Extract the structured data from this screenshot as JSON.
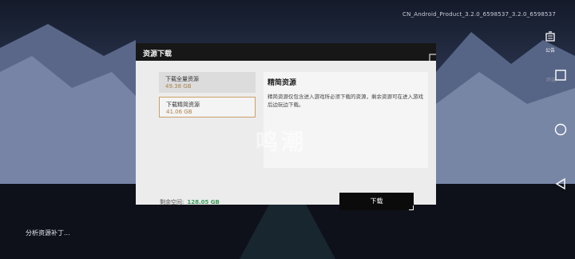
{
  "app": {
    "version": "CN_Android_Product_3.2.0_6598537_3.2.0_6598537",
    "status_text": "分析资源补丁...",
    "notice_label": "公告",
    "faint_label": "终端"
  },
  "dialog": {
    "title": "资源下载",
    "options": [
      {
        "label": "下载全量资源",
        "size": "49.38 GB",
        "selected": false
      },
      {
        "label": "下载精简资源",
        "size": "41.06 GB",
        "selected": true
      }
    ],
    "detail_title": "精简资源",
    "detail_desc": "精简资源仅包含进入游戏所必须下载的资源，剩余资源可在进入游戏后边玩边下载。",
    "watermark": "鸣潮",
    "free_space_label": "剩余空间:",
    "free_space_value": "128.05 GB",
    "download_label": "下载"
  },
  "colors": {
    "accent_gold": "#c9a06a",
    "size_text": "#a9824a",
    "free_space": "#3a9d5a",
    "header_bg": "#171717",
    "button_bg": "#0b0b0b"
  },
  "icons": {
    "notice": "notice-icon",
    "back": "back-triangle-icon",
    "home": "home-circle-icon",
    "recents": "recents-square-icon"
  }
}
